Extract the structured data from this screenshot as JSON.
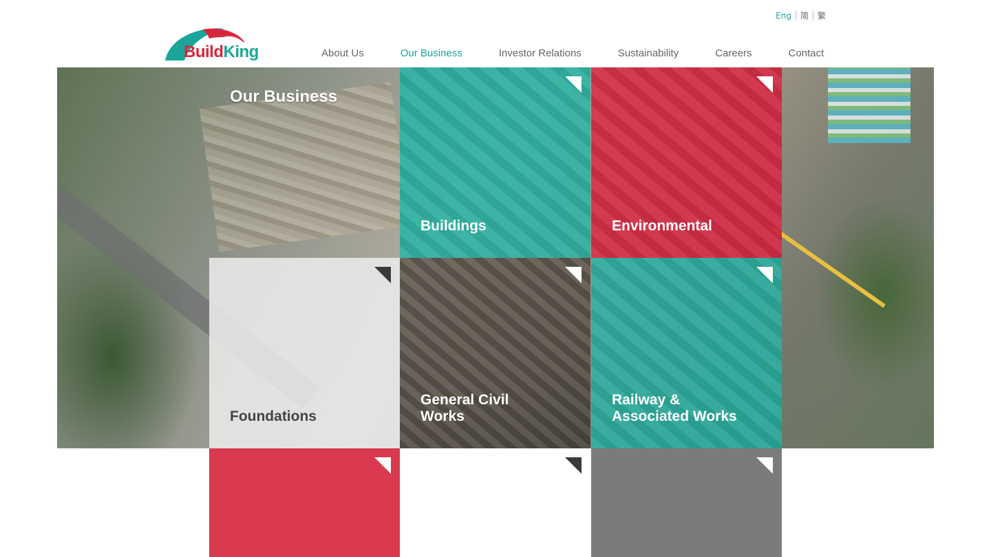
{
  "language": {
    "items": [
      {
        "label": "Eng",
        "active": true
      },
      {
        "label": "简",
        "active": false
      },
      {
        "label": "繁",
        "active": false
      }
    ]
  },
  "logo": {
    "text_left": "Build",
    "text_right": "King",
    "colors": {
      "red": "#d7263d",
      "teal": "#1aa59a"
    }
  },
  "nav": {
    "items": [
      {
        "label": "About Us",
        "active": false
      },
      {
        "label": "Our Business",
        "active": true
      },
      {
        "label": "Investor Relations",
        "active": false
      },
      {
        "label": "Sustainability",
        "active": false
      },
      {
        "label": "Careers",
        "active": false
      },
      {
        "label": "Contact",
        "active": false
      }
    ]
  },
  "hero": {
    "title": "Our Business"
  },
  "tiles": [
    {
      "label": "Buildings",
      "color": "#1aafa0",
      "corner": "light"
    },
    {
      "label": "Environmental",
      "color": "#d71e3c",
      "corner": "light"
    },
    {
      "label": "Foundations",
      "color": "#ebebeb",
      "corner": "dark"
    },
    {
      "label": "General Civil\nWorks",
      "color": "#4a4540",
      "corner": "light"
    },
    {
      "label": "Railway &\nAssociated Works",
      "color": "#1aafa0",
      "corner": "light"
    },
    {
      "label": "",
      "color": "#d93a4f",
      "corner": "light"
    },
    {
      "label": "",
      "color": "#ffffff",
      "corner": "dark"
    },
    {
      "label": "",
      "color": "#7b7b7b",
      "corner": "light"
    }
  ]
}
